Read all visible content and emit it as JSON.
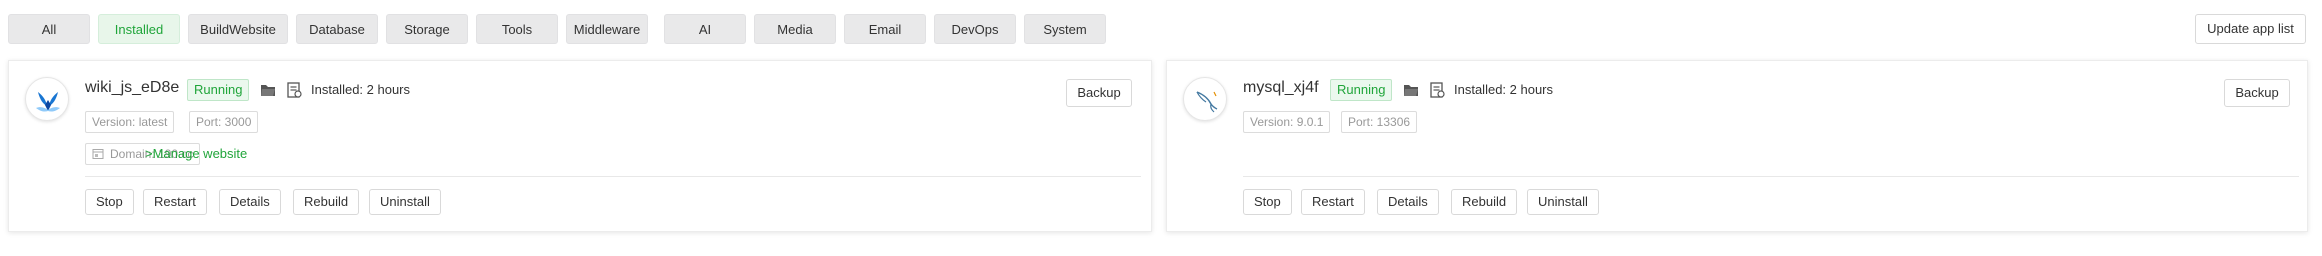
{
  "tabs": [
    {
      "label": "All",
      "active": false
    },
    {
      "label": "Installed",
      "active": true
    },
    {
      "label": "BuildWebsite",
      "active": false
    },
    {
      "label": "Database",
      "active": false
    },
    {
      "label": "Storage",
      "active": false
    },
    {
      "label": "Tools",
      "active": false
    },
    {
      "label": "Middleware",
      "active": false
    },
    {
      "label": "AI",
      "active": false
    },
    {
      "label": "Media",
      "active": false
    },
    {
      "label": "Email",
      "active": false
    },
    {
      "label": "DevOps",
      "active": false
    },
    {
      "label": "System",
      "active": false
    }
  ],
  "update_label": "Update app list",
  "apps": [
    {
      "name": "wiki_js_eD8e",
      "logo_icon": "wikijs-logo-icon",
      "status": "Running",
      "installed": "Installed: 2 hours",
      "version": "Version: latest",
      "port": "Port: 3000",
      "domain": "Domain: 190.cc",
      "manage": ">Manage website",
      "backup": "Backup",
      "actions": [
        "Stop",
        "Restart",
        "Details",
        "Rebuild",
        "Uninstall"
      ]
    },
    {
      "name": "mysql_xj4f",
      "logo_icon": "mysql-logo-icon",
      "status": "Running",
      "installed": "Installed: 2 hours",
      "version": "Version: 9.0.1",
      "port": "Port: 13306",
      "backup": "Backup",
      "actions": [
        "Stop",
        "Restart",
        "Details",
        "Rebuild",
        "Uninstall"
      ]
    }
  ],
  "colors": {
    "accent": "#20a53a",
    "tab_bg": "#e9e9ea",
    "active_tab_bg": "#e8f6ea"
  }
}
